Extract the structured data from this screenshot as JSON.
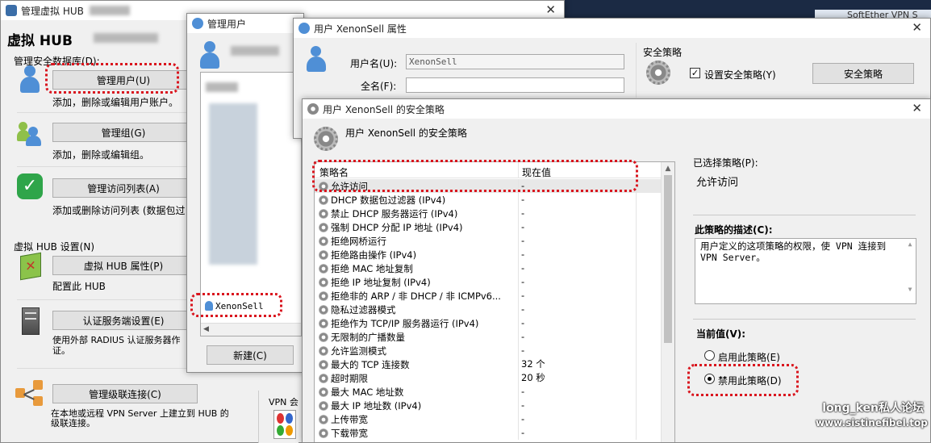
{
  "hub_window": {
    "title": "管理虚拟 HUB",
    "header": "虚拟 HUB",
    "section_db": "管理安全数据库(D):",
    "manage_users": {
      "label": "管理用户(U)",
      "desc": "添加，删除或编辑用户账户。"
    },
    "manage_groups": {
      "label": "管理组(G)",
      "desc": "添加，删除或编辑组。"
    },
    "manage_acl": {
      "label": "管理访问列表(A)",
      "desc": "添加或删除访问列表 (数据包过"
    },
    "section_hub": "虚拟 HUB 设置(N)",
    "hub_props": {
      "label": "虚拟 HUB 属性(P)",
      "desc": "配置此 HUB"
    },
    "auth_server": {
      "label": "认证服务端设置(E)",
      "desc": "使用外部 RADIUS 认证服务器作证。"
    },
    "cascade": {
      "label": "管理级联连接(C)",
      "desc": "在本地或远程 VPN Server 上建立到 HUB 的级联连接。"
    }
  },
  "users_window": {
    "title": "管理用户",
    "selected_user": "XenonSell",
    "new_button": "新建(C)",
    "vpn_label": "VPN 会"
  },
  "props_window": {
    "title": "用户 XenonSell 属性",
    "username_label": "用户名(U):",
    "username_value": "XenonSell",
    "fullname_label": "全名(F):",
    "fullname_value": "",
    "security_group": "安全策略",
    "set_policy_checkbox": "设置安全策略(Y)",
    "set_policy_checked": true,
    "policy_button": "安全策略"
  },
  "policy_window": {
    "title": "用户 XenonSell 的安全策略",
    "heading": "用户 XenonSell 的安全策略",
    "col_name": "策略名",
    "col_value": "现在值",
    "rows": [
      {
        "name": "允许访问",
        "value": "-"
      },
      {
        "name": "DHCP 数据包过滤器 (IPv4)",
        "value": "-"
      },
      {
        "name": "禁止 DHCP 服务器运行 (IPv4)",
        "value": "-"
      },
      {
        "name": "强制 DHCP 分配 IP 地址 (IPv4)",
        "value": "-"
      },
      {
        "name": "拒绝网桥运行",
        "value": "-"
      },
      {
        "name": "拒绝路由操作 (IPv4)",
        "value": "-"
      },
      {
        "name": "拒绝 MAC 地址复制",
        "value": "-"
      },
      {
        "name": "拒绝 IP 地址复制 (IPv4)",
        "value": "-"
      },
      {
        "name": "拒绝非的 ARP / 非 DHCP / 非 ICMPv6...",
        "value": "-"
      },
      {
        "name": "隐私过滤器模式",
        "value": "-"
      },
      {
        "name": "拒绝作为 TCP/IP 服务器运行 (IPv4)",
        "value": "-"
      },
      {
        "name": "无限制的广播数量",
        "value": "-"
      },
      {
        "name": "允许监测模式",
        "value": "-"
      },
      {
        "name": "最大的 TCP 连接数",
        "value": "32 个"
      },
      {
        "name": "超时期限",
        "value": "20 秒"
      },
      {
        "name": "最大 MAC 地址数",
        "value": "-"
      },
      {
        "name": "最大 IP 地址数 (IPv4)",
        "value": "-"
      },
      {
        "name": "上传带宽",
        "value": "-"
      },
      {
        "name": "下载带宽",
        "value": "-"
      }
    ],
    "selected_label": "已选择策略(P):",
    "selected_value": "允许访问",
    "desc_label": "此策略的描述(C):",
    "desc_text": "用户定义的这项策略的权限，使 VPN 连接到 VPN Server。",
    "current_label": "当前值(V):",
    "enable_option": "启用此策略(E)",
    "disable_option": "禁用此策略(D)",
    "selected_option": "disable"
  },
  "watermark": {
    "line1": "long_ken私人论坛",
    "line2": "www.sistinefibel.top"
  },
  "background_window_text": "SoftEther VPN S"
}
